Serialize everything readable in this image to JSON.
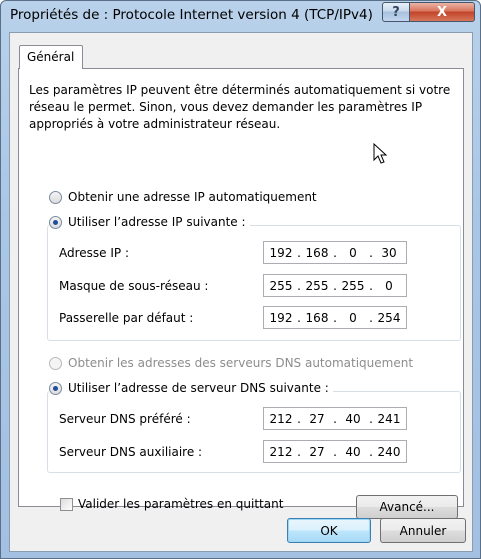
{
  "window": {
    "title": "Propriétés de : Protocole Internet version 4 (TCP/IPv4)"
  },
  "titlebar": {
    "help_label": "?",
    "close_label": "X"
  },
  "tabs": [
    {
      "label": "Général"
    }
  ],
  "description": [
    "Les paramètres IP peuvent être déterminés automatiquement si votre",
    "réseau le permet. Sinon, vous devez demander les paramètres IP",
    "appropriés à votre administrateur réseau."
  ],
  "ip_section": {
    "auto_label": "Obtenir une adresse IP automatiquement",
    "auto_selected": false,
    "manual_label": "Utiliser l’adresse IP suivante :",
    "manual_selected": true,
    "fields": [
      {
        "label": "Adresse IP :",
        "octets": [
          "192",
          "168",
          "0",
          "30"
        ]
      },
      {
        "label": "Masque de sous-réseau :",
        "octets": [
          "255",
          "255",
          "255",
          "0"
        ]
      },
      {
        "label": "Passerelle par défaut :",
        "octets": [
          "192",
          "168",
          "0",
          "254"
        ]
      }
    ]
  },
  "dns_section": {
    "auto_label": "Obtenir les adresses des serveurs DNS automatiquement",
    "auto_selected": false,
    "auto_disabled": true,
    "manual_label": "Utiliser l’adresse de serveur DNS suivante :",
    "manual_selected": true,
    "fields": [
      {
        "label": "Serveur DNS préféré :",
        "octets": [
          "212",
          "27",
          "40",
          "241"
        ]
      },
      {
        "label": "Serveur DNS auxiliaire :",
        "octets": [
          "212",
          "27",
          "40",
          "240"
        ]
      }
    ]
  },
  "validate_checkbox": {
    "label": "Valider les paramètres en quittant",
    "checked": false
  },
  "buttons": {
    "advanced": "Avancé...",
    "ok": "OK",
    "cancel": "Annuler"
  }
}
